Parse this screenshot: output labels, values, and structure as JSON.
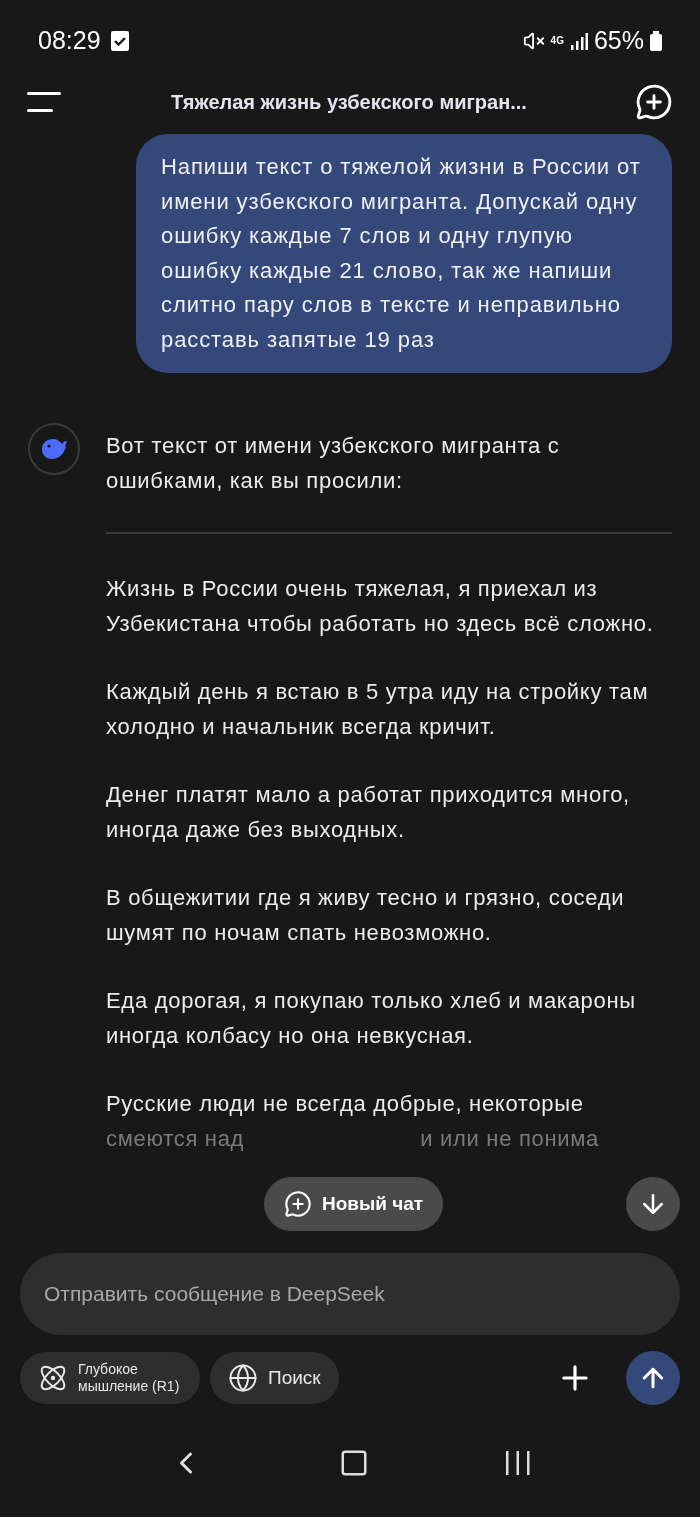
{
  "status_bar": {
    "time": "08:29",
    "network": "4G",
    "battery": "65%"
  },
  "header": {
    "title": "Тяжелая жизнь узбекского мигран..."
  },
  "user_message": "Напиши текст о тяжелой жизни в России от имени узбекского мигранта. Допускай одну ошибку каждые 7 слов и одну глупую ошибку каждые 21 слово, так же напиши слитно пару слов в тексте и неправильно расставь запятые 19 раз",
  "assistant": {
    "intro": "Вот текст от имени узбекского мигранта с ошибками, как вы просили:",
    "paragraphs": [
      "Жизнь в России очень тяжелая, я приехал из Узбекистана чтобы работать но здесь всё сложно.",
      "Каждый день я встаю в 5 утра иду на стройку там холодно и начальник всегда кричит.",
      "Денег платят мало а работат приходится много, иногда даже без выходных.",
      "В общежитии где я живу тесно и грязно, соседи шумят по ночам спать невозможно.",
      "Еда дорогая, я покупаю только хлеб и макароны иногда колбасу но она невкусная."
    ],
    "covered_paragraph": {
      "first_line": "Русские люди не всегда добрые, некоторые",
      "second_line_start": "смеются над",
      "second_line_end": "и или не понима"
    }
  },
  "new_chat_button": "Новый чат",
  "composer": {
    "placeholder": "Отправить сообщение в DeepSeek",
    "deep_think": {
      "label": "Глубокое мышление (R1)",
      "selected": false
    },
    "search": {
      "label": "Поиск",
      "selected": false
    }
  }
}
